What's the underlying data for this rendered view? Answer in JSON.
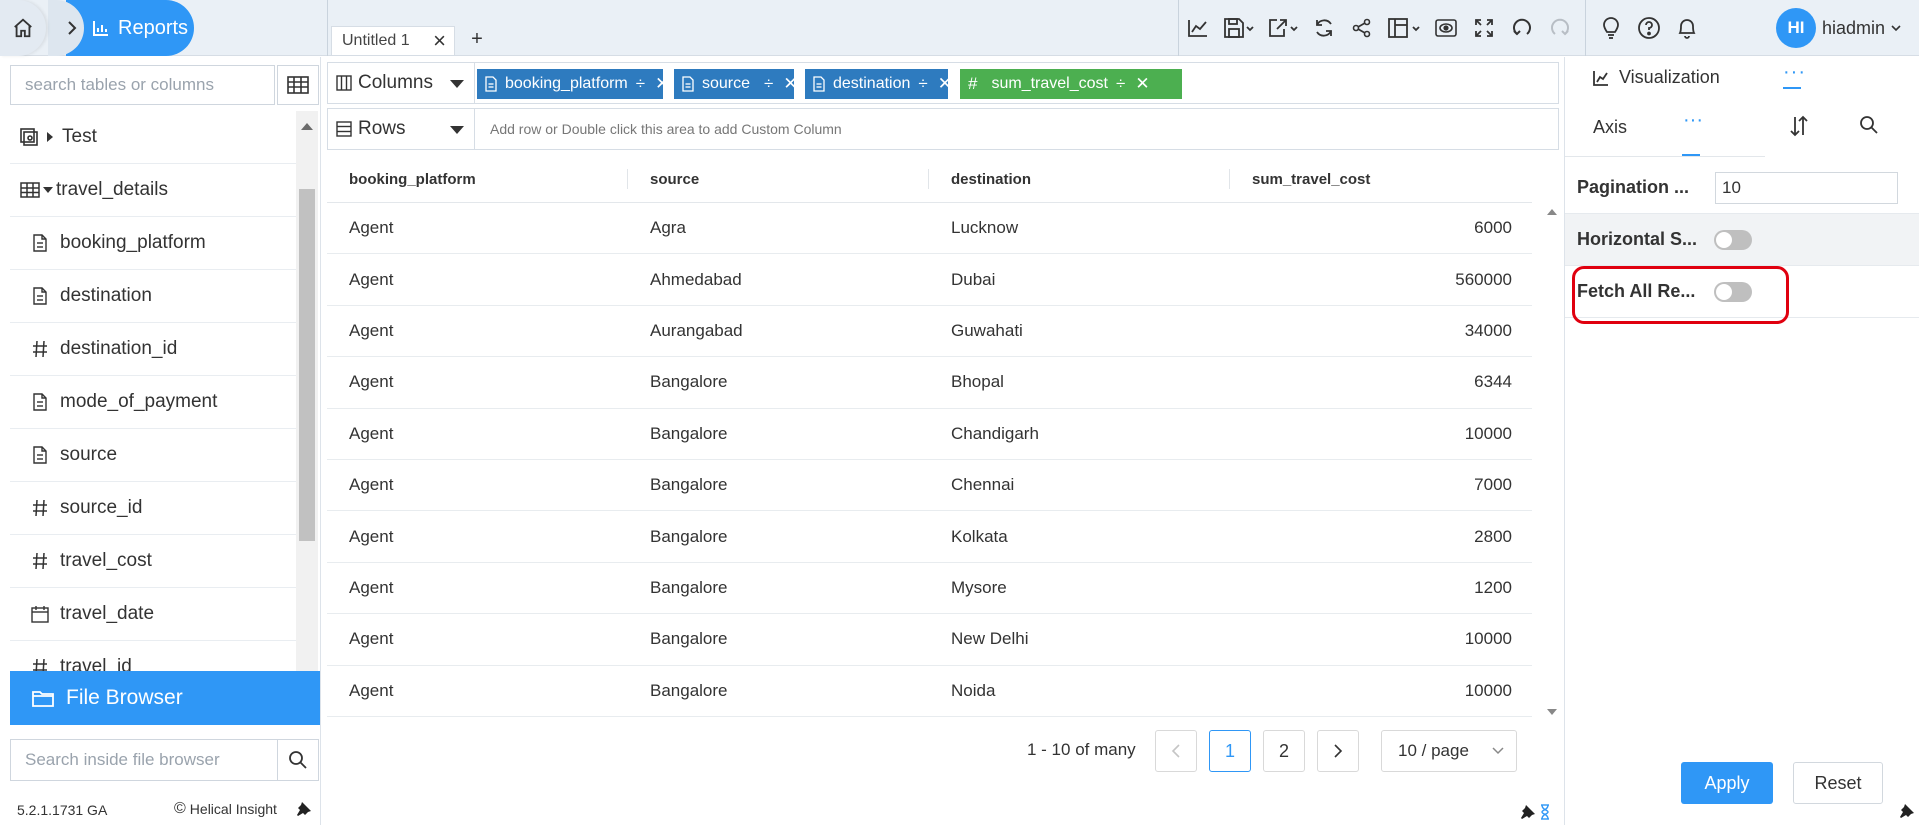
{
  "app": {
    "breadcrumb_label": "Reports",
    "tab_title": "Untitled 1",
    "tab_close": "×",
    "tab_add": "+",
    "user_initials": "HI",
    "username": "hiadmin",
    "accent_color": "#2f97f6"
  },
  "toolbar": {
    "icons": [
      "chart-icon",
      "save-icon",
      "export-icon",
      "refresh-icon",
      "share-icon",
      "layout-icon",
      "preview-icon",
      "expand-icon",
      "undo-icon",
      "redo-icon",
      "bulb-icon",
      "help-icon",
      "bell-icon"
    ]
  },
  "left": {
    "search_placeholder": "search tables or columns",
    "tree": [
      {
        "label": "Test",
        "type": "folder",
        "icon": "report-folder-icon"
      },
      {
        "label": "travel_details",
        "type": "table",
        "icon": "table-icon"
      },
      {
        "label": "booking_platform",
        "type": "text",
        "icon": "text-field-icon"
      },
      {
        "label": "destination",
        "type": "text",
        "icon": "text-field-icon"
      },
      {
        "label": "destination_id",
        "type": "number",
        "icon": "hash-icon"
      },
      {
        "label": "mode_of_payment",
        "type": "text",
        "icon": "text-field-icon"
      },
      {
        "label": "source",
        "type": "text",
        "icon": "text-field-icon"
      },
      {
        "label": "source_id",
        "type": "number",
        "icon": "hash-icon"
      },
      {
        "label": "travel_cost",
        "type": "number",
        "icon": "hash-icon"
      },
      {
        "label": "travel_date",
        "type": "date",
        "icon": "calendar-icon"
      },
      {
        "label": "travel_id",
        "type": "number",
        "icon": "hash-icon"
      }
    ],
    "file_browser_label": "File Browser",
    "file_search_placeholder": "Search inside file browser",
    "version": "5.2.1.1731 GA",
    "brand": "Helical Insight",
    "brand_mark": "©"
  },
  "shelves": {
    "columns_label": "Columns",
    "rows_label": "Rows",
    "rows_hint": "Add row or Double click this area to add Custom Column",
    "column_pills": [
      {
        "label": "booking_platform",
        "kind": "dimension"
      },
      {
        "label": "source",
        "kind": "dimension"
      },
      {
        "label": "destination",
        "kind": "dimension"
      },
      {
        "label": "sum_travel_cost",
        "kind": "measure"
      }
    ],
    "dimension_color": "#2e7bbf",
    "measure_color": "#4caf50"
  },
  "grid": {
    "headers": [
      "booking_platform",
      "source",
      "destination",
      "sum_travel_cost"
    ],
    "rows": [
      [
        "Agent",
        "Agra",
        "Lucknow",
        "6000"
      ],
      [
        "Agent",
        "Ahmedabad",
        "Dubai",
        "560000"
      ],
      [
        "Agent",
        "Aurangabad",
        "Guwahati",
        "34000"
      ],
      [
        "Agent",
        "Bangalore",
        "Bhopal",
        "6344"
      ],
      [
        "Agent",
        "Bangalore",
        "Chandigarh",
        "10000"
      ],
      [
        "Agent",
        "Bangalore",
        "Chennai",
        "7000"
      ],
      [
        "Agent",
        "Bangalore",
        "Kolkata",
        "2800"
      ],
      [
        "Agent",
        "Bangalore",
        "Mysore",
        "1200"
      ],
      [
        "Agent",
        "Bangalore",
        "New Delhi",
        "10000"
      ],
      [
        "Agent",
        "Bangalore",
        "Noida",
        "10000"
      ]
    ]
  },
  "pagination": {
    "info": "1 - 10 of many",
    "pages": [
      "1",
      "2"
    ],
    "current": "1",
    "page_size": "10 / page"
  },
  "right": {
    "tab_visualization": "Visualization",
    "tab_more": "···",
    "sub_axis": "Axis",
    "sub_more": "···",
    "props": {
      "pagination_label": "Pagination ...",
      "pagination_value": "10",
      "horizontal_label": "Horizontal S...",
      "horizontal_on": false,
      "fetch_label": "Fetch All Re...",
      "fetch_on": false
    },
    "apply_label": "Apply",
    "reset_label": "Reset",
    "highlight_color": "#e0000f"
  }
}
